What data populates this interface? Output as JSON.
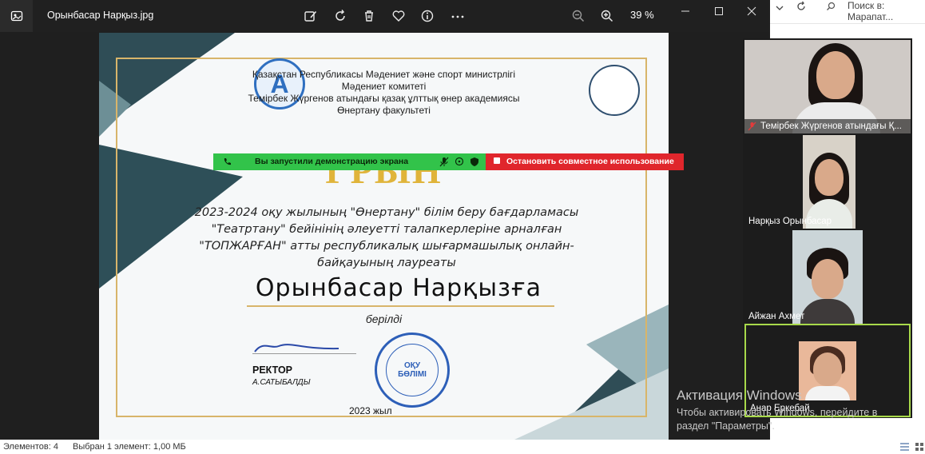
{
  "viewer": {
    "title": "Орынбасар Нарқыз.jpg",
    "zoom": "39 %"
  },
  "certificate": {
    "org_line1": "Қазақстан Республикасы Мәдениет және спорт министрлігі",
    "org_line2": "Мәдениет комитеті",
    "org_line3": "Темірбек Жүргенов атындағы қазақ ұлттық өнер академиясы",
    "org_line4": "Өнертану факультеті",
    "heading": "ГРЫН",
    "award_line1": "2023-2024 оқу жылының \"Өнертану\" білім беру бағдарламасы",
    "award_line2": "\"Театртану\" бейінінің әлеуетті талапкерлеріне арналған",
    "award_line3": "\"ТОПЖАРҒАН\" атты республикалық шығармашылық онлайн-",
    "award_line4": "байқауының лауреаты",
    "recipient": "Орынбасар Нарқызға",
    "given": "берілді",
    "rector_title": "РЕКТОР",
    "rector_name": "А.САТЫБАЛДЫ",
    "stamp_line1": "ОҚУ",
    "stamp_line2": "БӨЛІМІ",
    "year": "2023 жыл"
  },
  "share_bar": {
    "status": "Вы запустили демонстрацию экрана",
    "stop_label": "Остановить совместное использование",
    "accent": "#32c34a",
    "stop_color": "#e0262c"
  },
  "explorer": {
    "search_placeholder": "Поиск в: Марапат...",
    "status_items": "Элементов: 4",
    "status_selected": "Выбран 1 элемент: 1,00 МБ"
  },
  "participants": [
    {
      "name": "Темірбек Жүргенов атындағы Қ..."
    },
    {
      "name": "Нарқыз Орынбасар"
    },
    {
      "name": "Айжан Ахмет"
    },
    {
      "name": "Анар Еркебай"
    }
  ],
  "activation": {
    "line1": "Активация Windows",
    "line2": "Чтобы активировать Windows, перейдите в",
    "line3": "раздел \"Параметры\"."
  }
}
